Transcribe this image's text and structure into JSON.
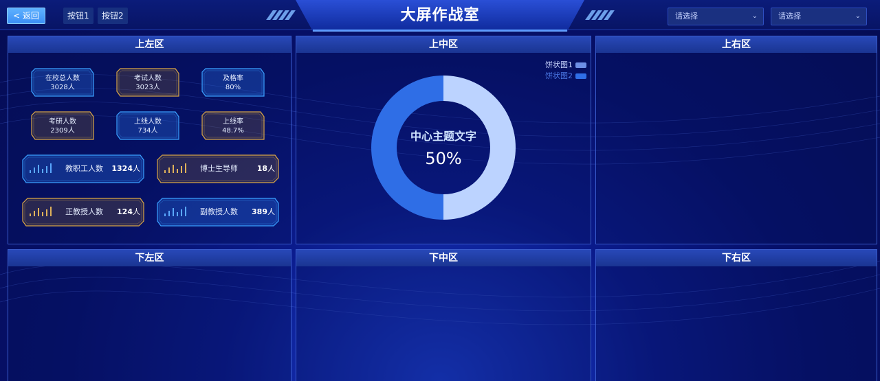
{
  "header": {
    "back_label": "< 返回",
    "button1_label": "按钮1",
    "button2_label": "按钮2",
    "title": "大屏作战室",
    "select1_placeholder": "请选择",
    "select2_placeholder": "请选择"
  },
  "panels": {
    "top_left": "上左区",
    "top_center": "上中区",
    "top_right": "上右区",
    "bottom_left": "下左区",
    "bottom_center": "下中区",
    "bottom_right": "下右区"
  },
  "stats": [
    {
      "label": "在校总人数",
      "value": "3028人",
      "color": "blue"
    },
    {
      "label": "考试人数",
      "value": "3023人",
      "color": "gold"
    },
    {
      "label": "及格率",
      "value": "80%",
      "color": "blue"
    },
    {
      "label": "考研人数",
      "value": "2309人",
      "color": "gold"
    },
    {
      "label": "上线人数",
      "value": "734人",
      "color": "blue"
    },
    {
      "label": "上线率",
      "value": "48.7%",
      "color": "gold"
    }
  ],
  "wide_stats": [
    {
      "label": "教职工人数",
      "number": "1324",
      "unit": "人",
      "color": "blue"
    },
    {
      "label": "博士生导师",
      "number": "18",
      "unit": "人",
      "color": "gold"
    },
    {
      "label": "正教授人数",
      "number": "124",
      "unit": "人",
      "color": "gold"
    },
    {
      "label": "副教授人数",
      "number": "389",
      "unit": "人",
      "color": "blue"
    }
  ],
  "chart_data": {
    "type": "pie",
    "center_text": "中心主题文字",
    "center_value": "50%",
    "legend_placement": "top-right",
    "series": [
      {
        "name": "饼状图1",
        "value": 50,
        "color": "#bcd3ff"
      },
      {
        "name": "饼状图2",
        "value": 50,
        "color": "#2f6ee6"
      }
    ]
  },
  "colors": {
    "accent_blue": "#3aa0ff",
    "accent_gold": "#d9a646",
    "background": "#06106a"
  }
}
